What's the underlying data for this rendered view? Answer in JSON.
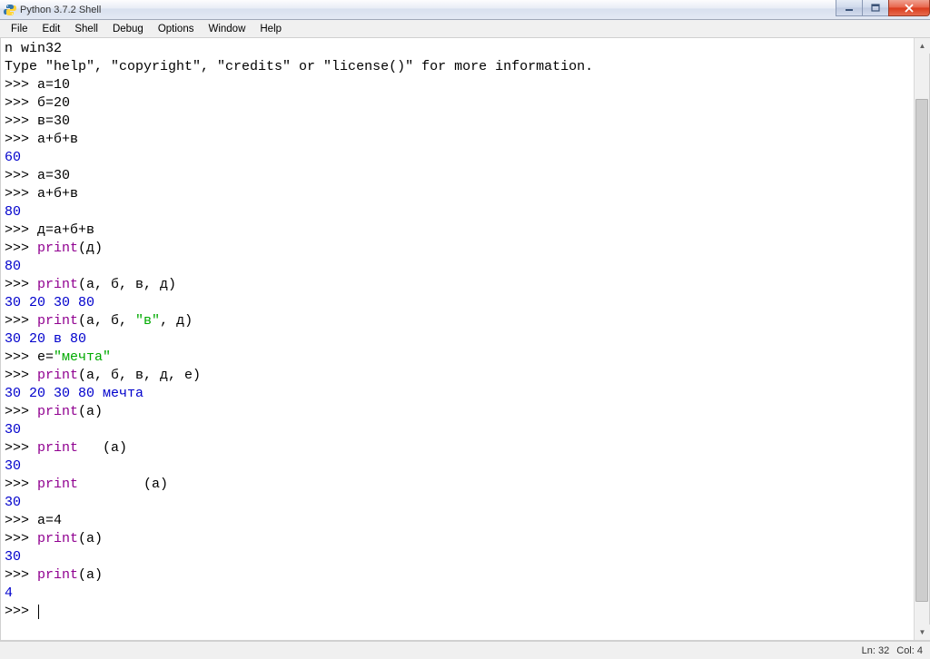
{
  "titlebar": {
    "title": "Python 3.7.2 Shell"
  },
  "menu": {
    "file": "File",
    "edit": "Edit",
    "shell": "Shell",
    "debug": "Debug",
    "options": "Options",
    "window": "Window",
    "help": "Help"
  },
  "shell": {
    "line_partial": "n win32",
    "banner": "Type \"help\", \"copyright\", \"credits\" or \"license()\" for more information.",
    "prompt": ">>> ",
    "in1": "а=10",
    "in2": "б=20",
    "in3": "в=30",
    "in4": "а+б+в",
    "out4": "60",
    "in5": "а=30",
    "in6": "а+б+в",
    "out6": "80",
    "in7": "д=а+б+в",
    "in8_a": "print",
    "in8_b": "(д)",
    "out8": "80",
    "in9_a": "print",
    "in9_b": "(а, б, в, д)",
    "out9": "30 20 30 80",
    "in10_a": "print",
    "in10_b": "(а, б, ",
    "in10_c": "\"в\"",
    "in10_d": ", д)",
    "out10": "30 20 в 80",
    "in11_a": "е=",
    "in11_b": "\"мечта\"",
    "in12_a": "print",
    "in12_b": "(а, б, в, д, е)",
    "out12": "30 20 30 80 мечта",
    "in13_a": "print",
    "in13_b": "(а)",
    "out13": "30",
    "in14_a": "print",
    "in14_b": "   (а)",
    "out14": "30",
    "in15_a": "print",
    "in15_b": "        (а)",
    "out15": "30",
    "in16": "а=4",
    "in17_a": "print",
    "in17_b": "(a)",
    "out17": "30",
    "in18_a": "print",
    "in18_b": "(а)",
    "out18": "4"
  },
  "status": {
    "ln": "Ln: 32",
    "col": "Col: 4"
  }
}
